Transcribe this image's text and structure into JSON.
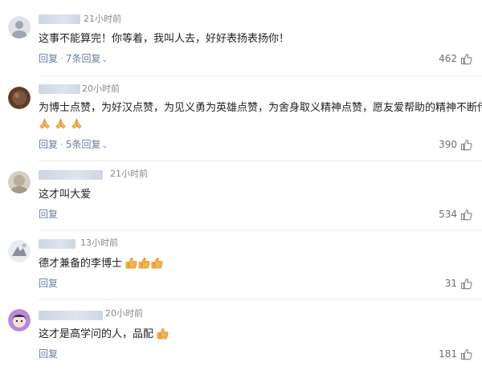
{
  "comments": [
    {
      "time": "21小时前",
      "text": "这事不能算完！你等着，我叫人去，好好表扬表扬你！",
      "reply_label": "回复",
      "replies_label": "7条回复",
      "likes": "462"
    },
    {
      "time": "20小时前",
      "text": "为博士点赞，为好汉点赞，为见义勇为英雄点赞，为舍身取义精神点赞，愿友爱帮助的精神不断传递",
      "emoji": "folded-hands x3",
      "reply_label": "回复",
      "replies_label": "5条回复",
      "likes": "390"
    },
    {
      "time": "21小时前",
      "text": "这才叫大爱",
      "reply_label": "回复",
      "likes": "534"
    },
    {
      "time": "13小时前",
      "text": "德才兼备的李博士",
      "emoji": "thumbs-up x3",
      "reply_label": "回复",
      "likes": "31"
    },
    {
      "time": "20小时前",
      "text": "这才是高学问的人，品配",
      "emoji": "thumbs-up x1",
      "reply_label": "回复",
      "likes": "181"
    }
  ],
  "icons": {
    "like": "thumbs-up-outline-icon",
    "expand": "chevron-down-icon"
  },
  "colors": {
    "link": "#6a7fa4",
    "text": "#222222",
    "meta": "#888888"
  }
}
